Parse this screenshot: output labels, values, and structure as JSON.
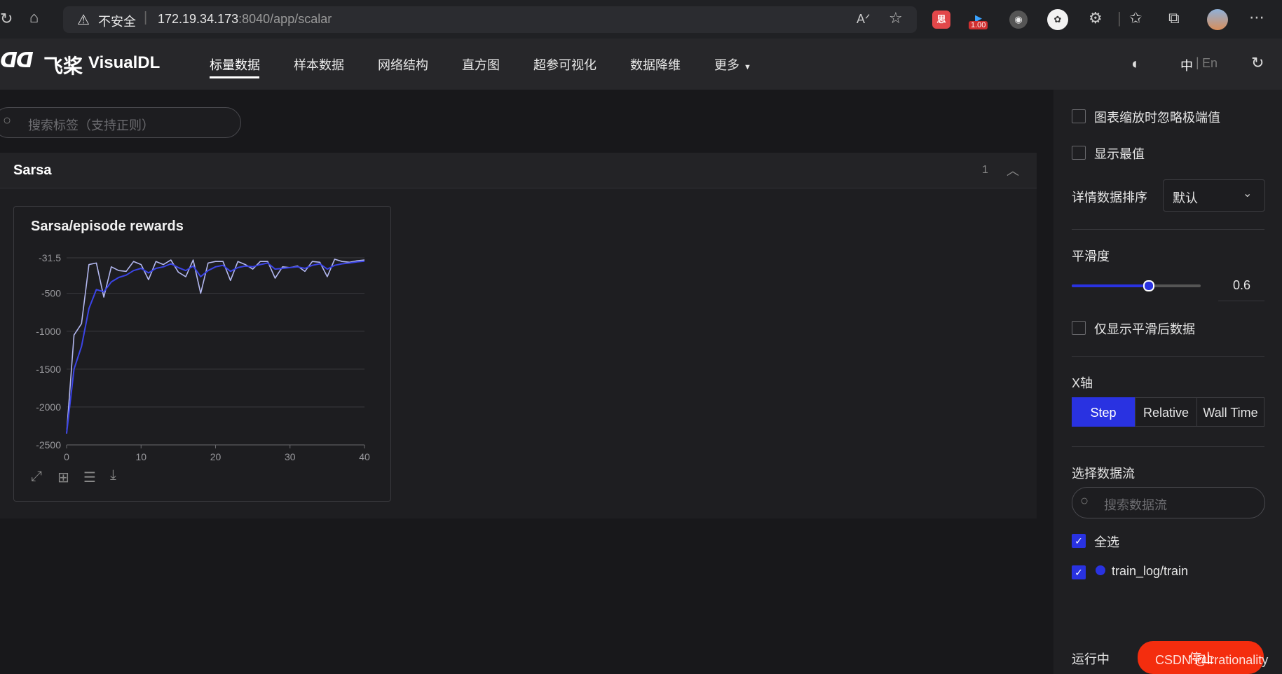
{
  "browser": {
    "security_label": "不安全",
    "url_host": "172.19.34.173",
    "url_rest": ":8040/app/scalar",
    "extension_badge": "1.00"
  },
  "app": {
    "brand_cn": "飞桨",
    "brand_en": "VisualDL",
    "nav": [
      "标量数据",
      "样本数据",
      "网络结构",
      "直方图",
      "超参可视化",
      "数据降维",
      "更多"
    ],
    "active_nav": "标量数据",
    "lang_zh": "中",
    "lang_sep": "|",
    "lang_en": "En"
  },
  "main": {
    "search_placeholder": "搜索标签（支持正则）",
    "group_title": "Sarsa",
    "group_count": "1",
    "chart_title": "Sarsa/episode rewards"
  },
  "chart_data": {
    "type": "line",
    "title": "Sarsa/episode rewards",
    "x_ticks": [
      "0",
      "10",
      "20",
      "30",
      "40"
    ],
    "y_ticks": [
      "-31.5",
      "-500",
      "-1000",
      "-1500",
      "-2000",
      "-2500"
    ],
    "xlim": [
      0,
      40
    ],
    "ylim": [
      -2500,
      -31.5
    ],
    "grid": true,
    "series": [
      {
        "role": "raw",
        "color": "#b3b8f0",
        "x": [
          0,
          1,
          2,
          3,
          4,
          5,
          6,
          7,
          8,
          9,
          10,
          11,
          12,
          13,
          14,
          15,
          16,
          17,
          18,
          19,
          20,
          21,
          22,
          23,
          24,
          25,
          26,
          27,
          28,
          29,
          30,
          31,
          32,
          33,
          34,
          35,
          36,
          37,
          38,
          39,
          40
        ],
        "y": [
          -2350,
          -1050,
          -900,
          -120,
          -100,
          -550,
          -150,
          -200,
          -210,
          -80,
          -120,
          -320,
          -80,
          -120,
          -60,
          -220,
          -280,
          -60,
          -500,
          -100,
          -80,
          -80,
          -330,
          -80,
          -120,
          -180,
          -80,
          -80,
          -300,
          -150,
          -160,
          -140,
          -210,
          -80,
          -90,
          -280,
          -50,
          -80,
          -90,
          -70,
          -60
        ]
      },
      {
        "role": "smoothed",
        "color": "#3b44e6",
        "x": [
          0,
          1,
          2,
          3,
          4,
          5,
          6,
          7,
          8,
          9,
          10,
          11,
          12,
          13,
          14,
          15,
          16,
          17,
          18,
          19,
          20,
          21,
          22,
          23,
          24,
          25,
          26,
          27,
          28,
          29,
          30,
          31,
          32,
          33,
          34,
          35,
          36,
          37,
          38,
          39,
          40
        ],
        "y": [
          -2350,
          -1500,
          -1200,
          -700,
          -450,
          -480,
          -350,
          -290,
          -260,
          -200,
          -170,
          -230,
          -170,
          -150,
          -110,
          -160,
          -200,
          -140,
          -280,
          -200,
          -150,
          -130,
          -210,
          -160,
          -140,
          -150,
          -120,
          -100,
          -180,
          -170,
          -160,
          -150,
          -170,
          -130,
          -110,
          -180,
          -130,
          -110,
          -100,
          -85,
          -75
        ]
      }
    ]
  },
  "sidebar": {
    "ignore_outliers_label": "图表缩放时忽略极端值",
    "show_extremes_label": "显示最值",
    "sort_label": "详情数据排序",
    "sort_value": "默认",
    "smoothing_label": "平滑度",
    "smoothing_value": "0.6",
    "smoothing_level": 0.6,
    "smoothed_only_label": "仅显示平滑后数据",
    "xaxis_label": "X轴",
    "xaxis_options": [
      "Step",
      "Relative",
      "Wall Time"
    ],
    "xaxis_selected": "Step",
    "runs_label": "选择数据流",
    "runs_search_placeholder": "搜索数据流",
    "select_all_label": "全选",
    "run_name": "train_log/train",
    "run_color": "#2932e1",
    "status_label": "运行中",
    "stop_label": "停止"
  },
  "watermark": "CSDN @irrationality",
  "colors": {
    "accent": "#2932e1",
    "stop": "#f42d0e"
  }
}
